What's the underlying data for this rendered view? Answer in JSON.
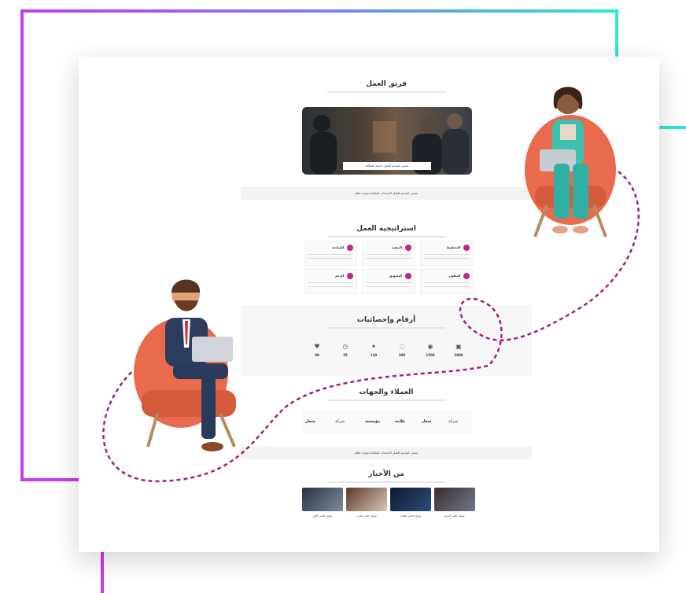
{
  "colors": {
    "frame_gradient_start": "#c43cf0",
    "frame_gradient_end": "#2ee6d6",
    "accent": "#c2287a",
    "chair": "#e96a4c",
    "dash_path": "#a0207c"
  },
  "site": {
    "team": {
      "title": "فريق العمل",
      "hero_caption": "نسعى لتقديم أفضل خدمة لعملائنا"
    },
    "band1": "نسعى لتقديم أفضل الخدمات لعملائنا بجودة عالية",
    "strategy": {
      "title": "استراتيجية العمل",
      "cards": [
        {
          "label": "التخطيط"
        },
        {
          "label": "التنفيذ"
        },
        {
          "label": "المتابعة"
        },
        {
          "label": "التطوير"
        },
        {
          "label": "التسويق"
        },
        {
          "label": "الدعم"
        }
      ]
    },
    "numbers": {
      "title": "أرقام وإحصائيات",
      "stats": [
        {
          "icon": "briefcase-icon",
          "value": "2000"
        },
        {
          "icon": "user-icon",
          "value": "1500"
        },
        {
          "icon": "lightbulb-icon",
          "value": "300"
        },
        {
          "icon": "star-icon",
          "value": "120"
        },
        {
          "icon": "clock-icon",
          "value": "25"
        },
        {
          "icon": "heart-icon",
          "value": "99"
        }
      ]
    },
    "clients": {
      "title": "العملاء والجهات",
      "logos": [
        "شعار",
        "شركة",
        "مؤسسة",
        "علامة",
        "شعار",
        "شركة"
      ]
    },
    "band2": "نسعى لتقديم أفضل الخدمات لعملائنا بجودة عالية",
    "blog": {
      "title": "من الأخبار",
      "posts": [
        {
          "caption": "عنوان الخبر الأول"
        },
        {
          "caption": "عنوان الخبر الثاني"
        },
        {
          "caption": "عنوان الخبر الثالث"
        },
        {
          "caption": "عنوان الخبر الرابع"
        }
      ]
    }
  }
}
